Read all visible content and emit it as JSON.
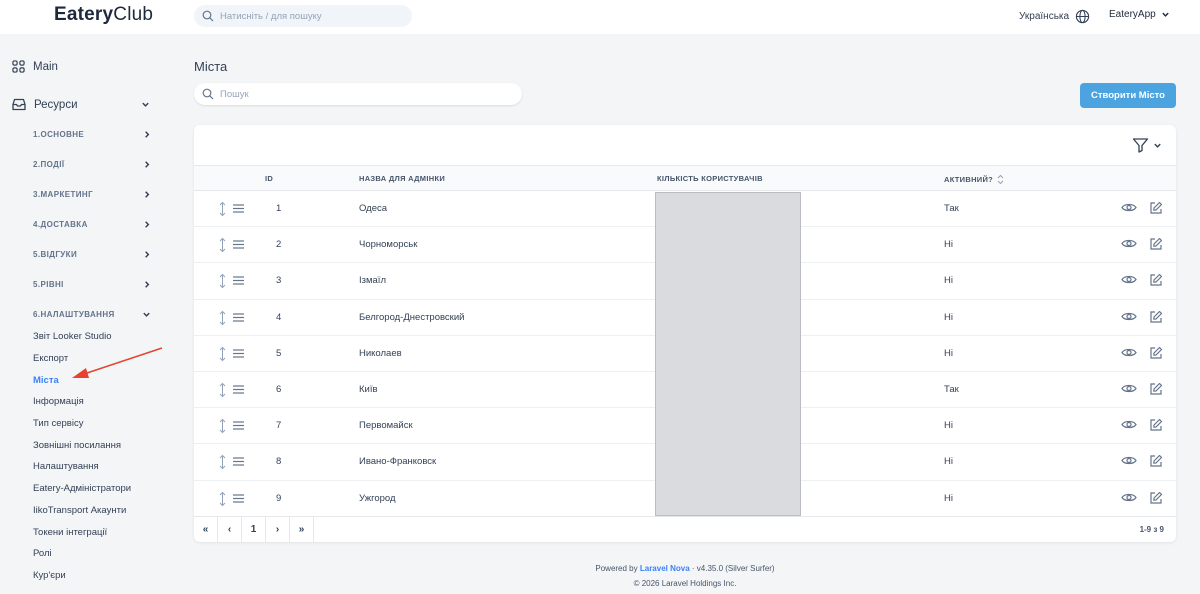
{
  "header": {
    "brand_bold": "Eatery",
    "brand_light": "Club",
    "search_placeholder": "Натисніть / для пошуку",
    "language": "Українська",
    "user": "EateryApp"
  },
  "sidebar": {
    "main": "Main",
    "resources": "Ресурси",
    "groups": [
      {
        "label": "1.ОСНОВНЕ"
      },
      {
        "label": "2.ПОДІЇ"
      },
      {
        "label": "3.МАРКЕТИНГ"
      },
      {
        "label": "4.ДОСТАВКА"
      },
      {
        "label": "5.ВІДГУКИ"
      },
      {
        "label": "5.РІВНІ"
      },
      {
        "label": "6.НАЛАШТУВАННЯ"
      }
    ],
    "items": [
      {
        "label": "Звіт Looker Studio"
      },
      {
        "label": "Експорт"
      },
      {
        "label": "Міста"
      },
      {
        "label": "Інформація"
      },
      {
        "label": "Тип сервісу"
      },
      {
        "label": "Зовнішні посилання"
      },
      {
        "label": "Налаштування"
      },
      {
        "label": "Eatery-Адміністратори"
      },
      {
        "label": "IikoTransport Акаунти"
      },
      {
        "label": "Токени інтеграції"
      },
      {
        "label": "Ролі"
      },
      {
        "label": "Кур'єри"
      }
    ]
  },
  "main": {
    "title": "Міста",
    "search_placeholder": "Пошук",
    "create_button": "Створити Місто",
    "columns": {
      "id": "ID",
      "name": "НАЗВА ДЛЯ АДМІНКИ",
      "users": "КІЛЬКІСТЬ КОРИСТУВАЧІВ",
      "active": "АКТИВНИЙ?"
    },
    "rows": [
      {
        "id": "1",
        "name": "Одеса",
        "active": "Так"
      },
      {
        "id": "2",
        "name": "Чорноморськ",
        "active": "Ні"
      },
      {
        "id": "3",
        "name": "Ізмаїл",
        "active": "Ні"
      },
      {
        "id": "4",
        "name": "Белгород-Днестровский",
        "active": "Ні"
      },
      {
        "id": "5",
        "name": "Николаев",
        "active": "Ні"
      },
      {
        "id": "6",
        "name": "Київ",
        "active": "Так"
      },
      {
        "id": "7",
        "name": "Первомайск",
        "active": "Ні"
      },
      {
        "id": "8",
        "name": "Ивано-Франковск",
        "active": "Ні"
      },
      {
        "id": "9",
        "name": "Ужгород",
        "active": "Ні"
      }
    ],
    "pager": {
      "first": "«",
      "prev": "‹",
      "page": "1",
      "next": "›",
      "last": "»",
      "count": "1-9 з 9"
    }
  },
  "footer": {
    "powered_by": "Powered by",
    "nova": "Laravel Nova",
    "version": "· v4.35.0 (Silver Surfer)",
    "copyright": "© 2026 Laravel Holdings Inc."
  },
  "colors": {
    "accent": "#4ba3e0",
    "active_link": "#3b82f6",
    "redaction": "#d9dbdf"
  }
}
